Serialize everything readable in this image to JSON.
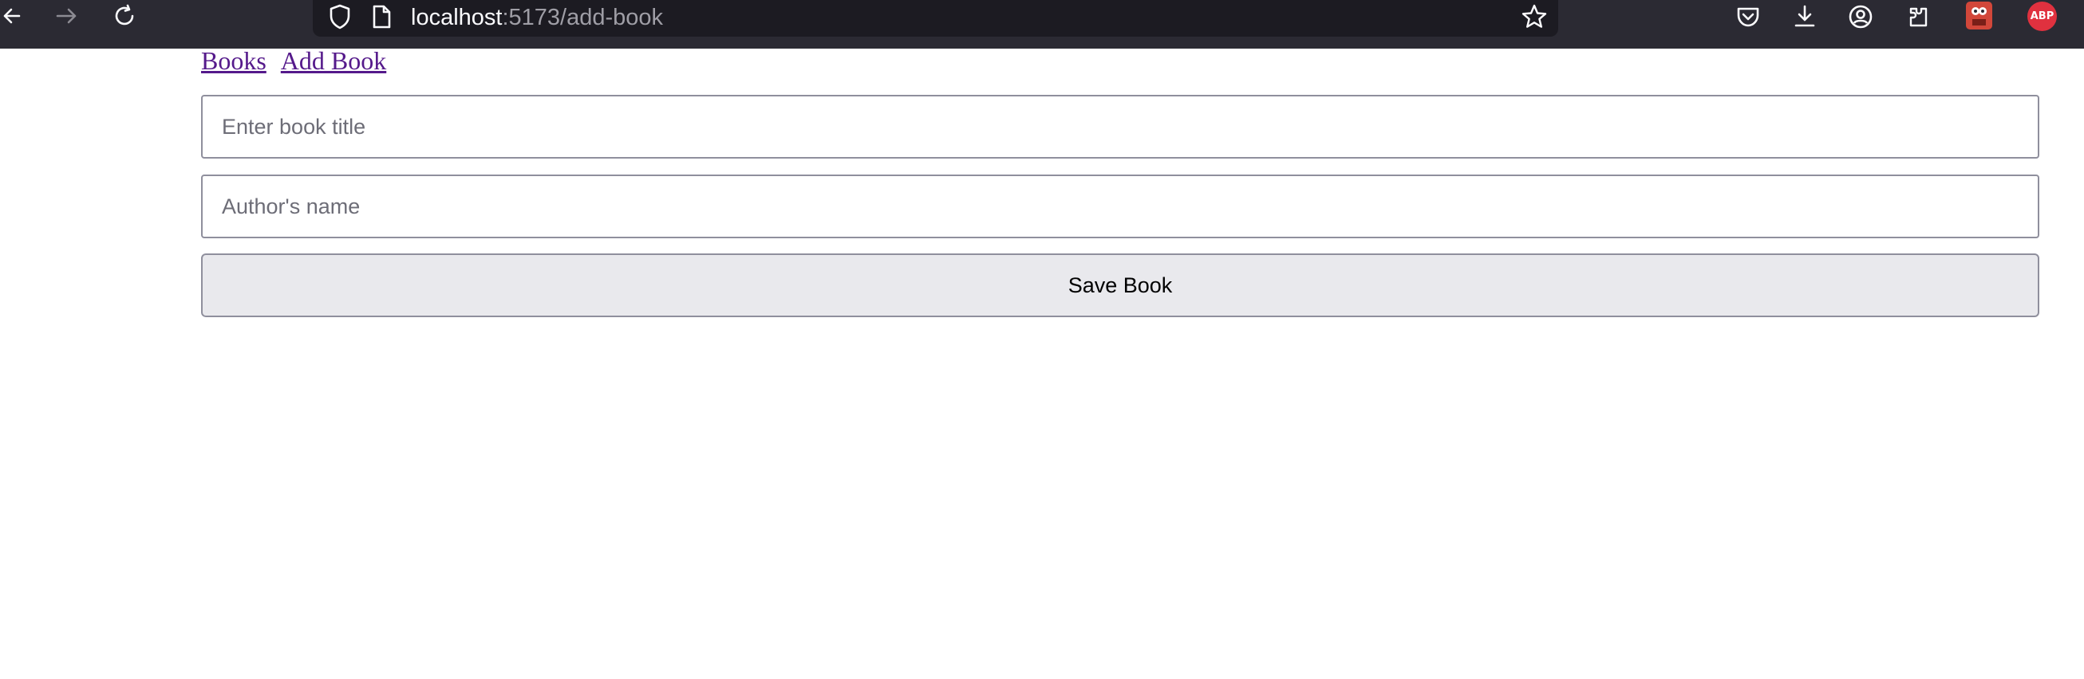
{
  "browser": {
    "url_host": "localhost",
    "url_path": ":5173/add-book",
    "extension_badge": "ABP",
    "icons": [
      "back-icon",
      "forward-icon",
      "reload-icon",
      "shield-icon",
      "page-icon",
      "bookmark-star-icon",
      "pocket-icon",
      "download-icon",
      "account-icon",
      "extensions-icon",
      "extension-tile-icon",
      "adblock-plus-icon"
    ]
  },
  "nav": {
    "books_link": "Books",
    "add_book_link": "Add Book"
  },
  "form": {
    "title_placeholder": "Enter book title",
    "title_value": "",
    "author_placeholder": "Author's name",
    "author_value": "",
    "save_label": "Save Book"
  },
  "colors": {
    "toolbar_bg": "#2b2a33",
    "urlbar_bg": "#1c1b22",
    "link": "#551a8b",
    "button_bg": "#e9e9ed",
    "abp_red": "#e0313f"
  }
}
